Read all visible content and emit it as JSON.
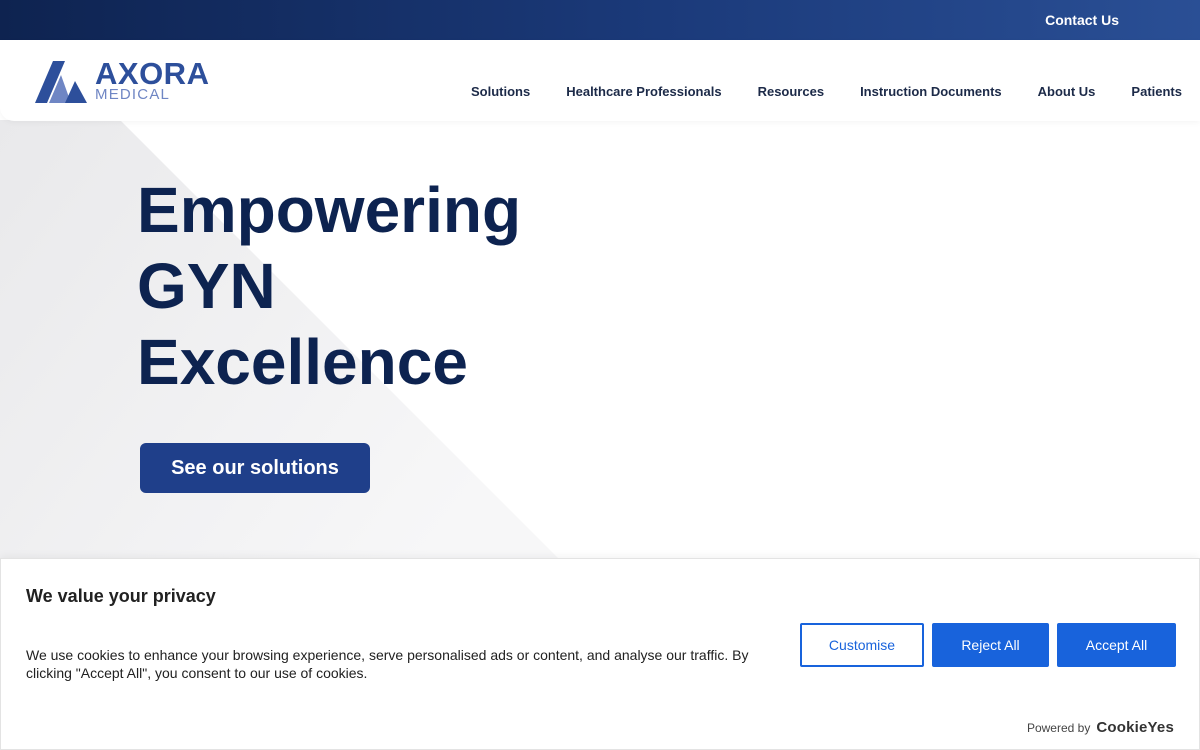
{
  "topbar": {
    "contact_label": "Contact Us"
  },
  "logo": {
    "word": "AXORA",
    "sub": "MEDICAL"
  },
  "nav": {
    "items": [
      {
        "label": "Solutions"
      },
      {
        "label": "Healthcare Professionals"
      },
      {
        "label": "Resources"
      },
      {
        "label": "Instruction Documents"
      },
      {
        "label": "About Us"
      },
      {
        "label": "Patients"
      }
    ]
  },
  "hero": {
    "title_lines": [
      "Empowering",
      "GYN",
      "Excellence"
    ],
    "cta_label": "See our solutions"
  },
  "cookie": {
    "title": "We value your privacy",
    "text": "We use cookies to enhance your browsing experience, serve personalised ads or content, and analyse our traffic. By clicking \"Accept All\", you consent to our use of cookies.",
    "customise_label": "Customise",
    "reject_label": "Reject All",
    "accept_label": "Accept All",
    "powered_label": "Powered by",
    "powered_brand": "CookieYes"
  },
  "colors": {
    "brand_navy": "#0d2350",
    "brand_blue": "#1f3f8a",
    "cookie_blue": "#1863dc"
  }
}
